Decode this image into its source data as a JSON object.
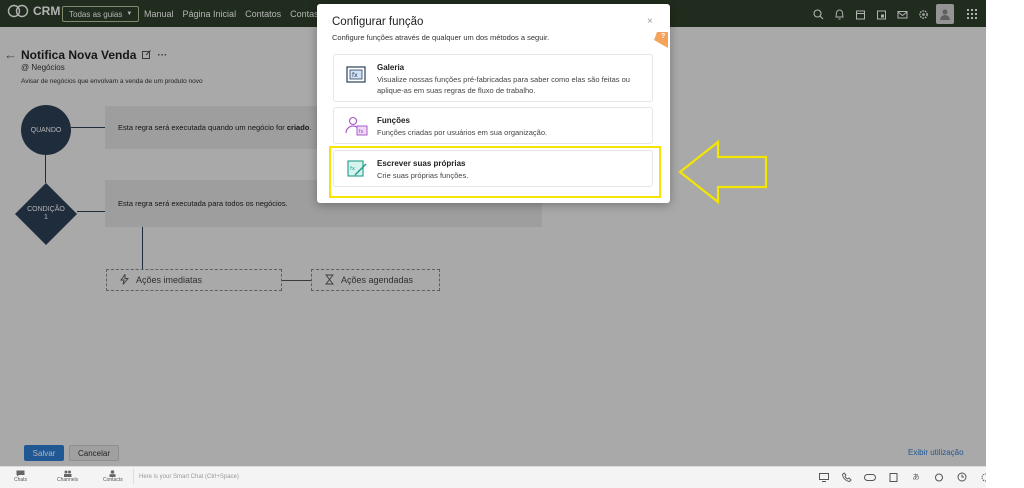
{
  "app": {
    "logo_text": "CRM",
    "modules_label": "Todas as guias",
    "nav": [
      "Manual",
      "Página Inicial",
      "Contatos",
      "Contas"
    ]
  },
  "rule": {
    "title": "Notifica Nova Venda",
    "module": "@ Negócios",
    "description": "Avisar de negócios que envolvam a venda de um produto novo",
    "when_label": "QUANDO",
    "when_text_prefix": "Esta regra será executada quando um negócio for ",
    "when_text_bold": "criado",
    "when_text_suffix": ".",
    "condition_label": "CONDIÇÃO",
    "condition_number": "1",
    "condition_text": "Esta regra será executada para todos os negócios.",
    "immediate_actions": "Ações imediatas",
    "scheduled_actions": "Ações agendadas"
  },
  "footer": {
    "save": "Salvar",
    "cancel": "Cancelar",
    "usage": "Exibir utilização"
  },
  "bottombar": {
    "items": [
      "Chats",
      "Channels",
      "Contacts"
    ],
    "chat_placeholder": "Here is your Smart Chat (Ctrl+Space)"
  },
  "modal": {
    "title": "Configurar função",
    "subtitle": "Configure funções através de qualquer um dos métodos a seguir.",
    "close": "×",
    "help": "?",
    "options": [
      {
        "title": "Galeria",
        "desc": "Visualize nossas funções pré-fabricadas para saber como elas são feitas ou aplique-as em suas regras de fluxo de trabalho."
      },
      {
        "title": "Funções",
        "desc": "Funções criadas por usuários em sua organização."
      },
      {
        "title": "Escrever suas próprias",
        "desc": "Crie suas próprias funções."
      }
    ]
  },
  "colors": {
    "topbar": "#2f3f2a",
    "node": "#2b4057",
    "primary": "#2f7fd4",
    "highlight": "#f4e600"
  }
}
